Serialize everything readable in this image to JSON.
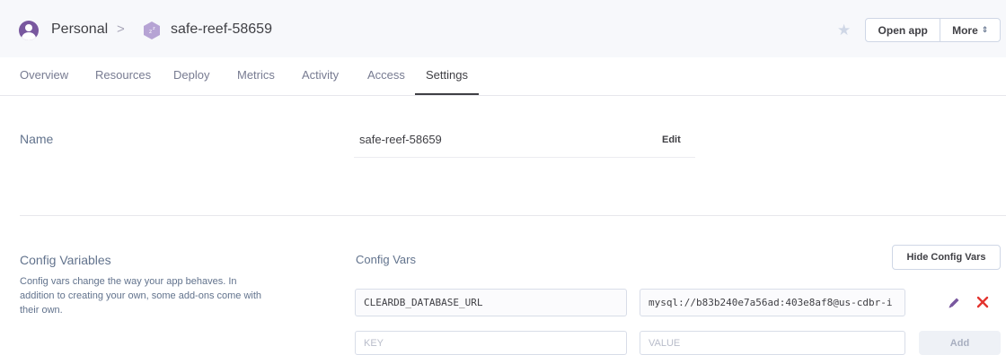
{
  "header": {
    "personal_label": "Personal",
    "separator": ">",
    "app_name": "safe-reef-58659",
    "open_app_label": "Open app",
    "more_label": "More",
    "more_chevron": "⇕",
    "star_glyph": "★"
  },
  "tabs": [
    {
      "label": "Overview"
    },
    {
      "label": "Resources"
    },
    {
      "label": "Deploy"
    },
    {
      "label": "Metrics"
    },
    {
      "label": "Activity"
    },
    {
      "label": "Access"
    },
    {
      "label": "Settings",
      "active": true
    }
  ],
  "name_section": {
    "title": "Name",
    "value": "safe-reef-58659",
    "edit_label": "Edit"
  },
  "config_section": {
    "title": "Config Variables",
    "description": "Config vars change the way your app behaves. In addition to creating your own, some add-ons come with their own.",
    "config_vars_label": "Config Vars",
    "hide_button_label": "Hide Config Vars",
    "vars": [
      {
        "key": "CLEARDB_DATABASE_URL",
        "value": "mysql://b83b240e7a56ad:403e8af8@us-cdbr-i"
      }
    ],
    "key_placeholder": "KEY",
    "value_placeholder": "VALUE",
    "add_label": "Add"
  },
  "colors": {
    "accent_purple": "#79589f",
    "delete_red": "#e3342f",
    "edit_icon": "#79589f"
  }
}
